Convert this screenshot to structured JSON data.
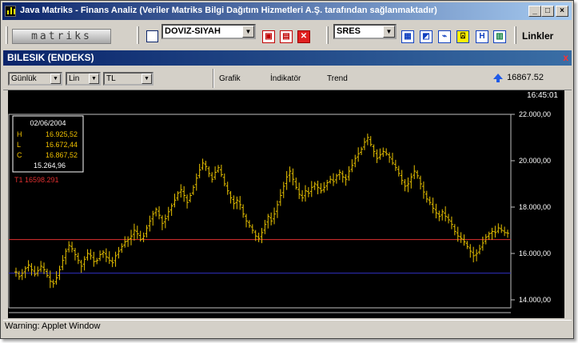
{
  "window": {
    "title": "Java Matriks - Finans Analiz (Veriler Matriks Bilgi Dağıtım Hizmetleri A.Ş. tarafından sağlanmaktadır)",
    "minimize": "_",
    "maximize": "□",
    "close": "×"
  },
  "toolbar": {
    "logo_text": "matriks",
    "currency_select": "DOVIZ-SIYAH",
    "symbol_select": "SRES",
    "links_label": "Linkler",
    "icons": [
      "save-icon",
      "print-icon",
      "delete-icon",
      "table-icon",
      "chart-icon",
      "line-icon",
      "alarm-icon",
      "news-icon",
      "calculator-icon"
    ]
  },
  "panel": {
    "title": "BILESIK (ENDEKS)",
    "close": "x"
  },
  "options": {
    "period": "Günlük",
    "scale": "Lin",
    "currency": "TL",
    "menu": [
      "Grafik",
      "İndikatör",
      "Trend"
    ],
    "last_price": "16867.52"
  },
  "chart": {
    "time": "16:45:01",
    "info_date": "02/06/2004",
    "info": [
      {
        "k": "H",
        "v": "16.925,52"
      },
      {
        "k": "L",
        "v": "16.672,44"
      },
      {
        "k": "C",
        "v": "16.867,52"
      }
    ],
    "info_extra": "15.264,96",
    "trend_label": "T1 16598.291",
    "colors": {
      "bars": "#e6c000",
      "trend": "#e03030",
      "baseline": "#3030c0",
      "frame": "#c0c0c0",
      "info": "#f0c000"
    }
  },
  "chart_data": {
    "type": "bar",
    "ylim": [
      13600,
      22200
    ],
    "y_ticks": [
      "22.000,00",
      "20.000,00",
      "18.000,00",
      "16.000,00",
      "14.000,00"
    ],
    "y_tick_values": [
      22000,
      20000,
      18000,
      16000,
      14000
    ],
    "reference_lines": {
      "trend": 16598.291,
      "baseline": 15150
    },
    "closes": [
      15200,
      15000,
      15150,
      15350,
      15500,
      15300,
      15100,
      15250,
      15450,
      15300,
      15050,
      14800,
      14700,
      14950,
      15300,
      15700,
      16100,
      16350,
      16200,
      15950,
      15700,
      15450,
      15750,
      16000,
      15900,
      15650,
      15700,
      15950,
      16050,
      15850,
      15700,
      15600,
      15900,
      16100,
      16300,
      16500,
      16600,
      16750,
      17000,
      16850,
      16600,
      16750,
      17100,
      17400,
      17700,
      17900,
      17650,
      17300,
      17500,
      17800,
      18050,
      18300,
      18600,
      18750,
      18500,
      18200,
      18500,
      18850,
      19250,
      19600,
      19900,
      19750,
      19450,
      19200,
      19500,
      19700,
      19400,
      19000,
      18700,
      18400,
      18150,
      18300,
      18100,
      17700,
      17400,
      17200,
      17000,
      16750,
      16650,
      16900,
      17250,
      17600,
      17400,
      17700,
      18100,
      18500,
      18900,
      19300,
      19550,
      19200,
      18850,
      18550,
      18400,
      18700,
      18600,
      18850,
      19000,
      18850,
      18700,
      18850,
      19050,
      19200,
      19100,
      19350,
      19500,
      19300,
      19200,
      19550,
      19800,
      20100,
      20300,
      20500,
      20800,
      21000,
      20700,
      20400,
      20100,
      20250,
      20400,
      20300,
      20150,
      19900,
      19700,
      19450,
      19150,
      18900,
      19000,
      19300,
      19550,
      19350,
      19000,
      18650,
      18350,
      18200,
      17950,
      17750,
      17600,
      17800,
      17600,
      17450,
      17250,
      16950,
      16750,
      16650,
      16500,
      16300,
      16100,
      15900,
      16000,
      16200,
      16450,
      16700,
      16850,
      16950,
      16900,
      17100,
      17000,
      16900,
      16870
    ]
  },
  "status": {
    "text": "Warning: Applet Window"
  }
}
